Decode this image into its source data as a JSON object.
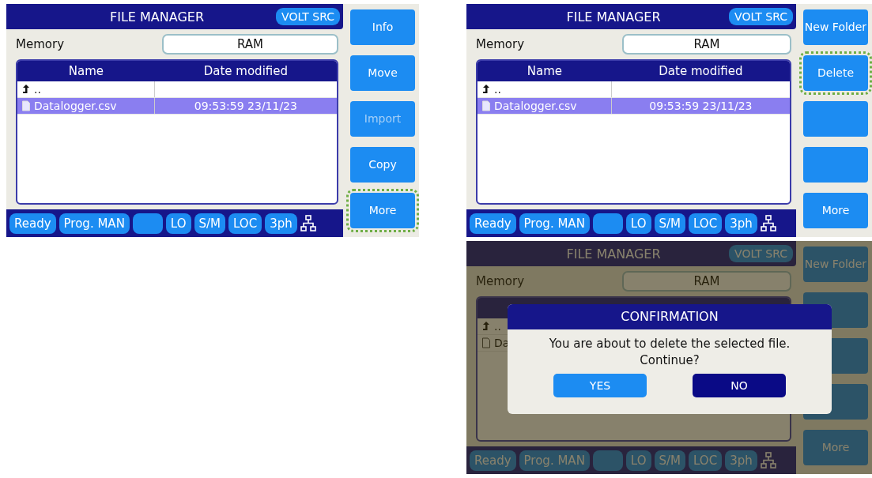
{
  "screens": [
    {
      "title": "FILE MANAGER",
      "mode": "VOLT SRC",
      "dimmed": false,
      "memory": {
        "label": "Memory",
        "value": "RAM"
      },
      "table": {
        "columns": [
          "Name",
          "Date modified"
        ],
        "rows": [
          {
            "kind": "parent",
            "name": "..",
            "selected": false
          },
          {
            "kind": "file",
            "name": "Datalogger.csv",
            "date": "09:53:59 23/11/23",
            "selected": true
          }
        ]
      },
      "status": [
        {
          "kind": "label",
          "text": "Ready"
        },
        {
          "kind": "label",
          "text": "Prog. MAN"
        },
        {
          "kind": "blank"
        },
        {
          "kind": "label",
          "text": "LO"
        },
        {
          "kind": "label",
          "text": "S/M"
        },
        {
          "kind": "label",
          "text": "LOC"
        },
        {
          "kind": "label",
          "text": "3ph"
        }
      ],
      "buttons": [
        {
          "label": "Info",
          "disabled": false,
          "focused": false
        },
        {
          "label": "Move",
          "disabled": false,
          "focused": false
        },
        {
          "label": "Import",
          "disabled": true,
          "focused": false
        },
        {
          "label": "Copy",
          "disabled": false,
          "focused": false
        },
        {
          "label": "More",
          "disabled": false,
          "focused": true
        }
      ]
    },
    {
      "title": "FILE MANAGER",
      "mode": "VOLT SRC",
      "dimmed": false,
      "memory": {
        "label": "Memory",
        "value": "RAM"
      },
      "table": {
        "columns": [
          "Name",
          "Date modified"
        ],
        "rows": [
          {
            "kind": "parent",
            "name": "..",
            "selected": false
          },
          {
            "kind": "file",
            "name": "Datalogger.csv",
            "date": "09:53:59 23/11/23",
            "selected": true
          }
        ]
      },
      "status": [
        {
          "kind": "label",
          "text": "Ready"
        },
        {
          "kind": "label",
          "text": "Prog. MAN"
        },
        {
          "kind": "blank"
        },
        {
          "kind": "label",
          "text": "LO"
        },
        {
          "kind": "label",
          "text": "S/M"
        },
        {
          "kind": "label",
          "text": "LOC"
        },
        {
          "kind": "label",
          "text": "3ph"
        }
      ],
      "buttons": [
        {
          "label": "New Folder",
          "disabled": false,
          "focused": false
        },
        {
          "label": "Delete",
          "disabled": false,
          "focused": true
        },
        {
          "disabled": false,
          "focused": false
        },
        {
          "disabled": false,
          "focused": false
        },
        {
          "label": "More",
          "disabled": false,
          "focused": false
        }
      ]
    },
    {
      "title": "FILE MANAGER",
      "mode": "VOLT SRC",
      "dimmed": true,
      "memory": {
        "label": "Memory",
        "value": "RAM"
      },
      "table": {
        "rows": [
          {
            "kind": "parent",
            "name": "..",
            "selected": false
          },
          {
            "kind": "file",
            "name": "Da",
            "selected": false
          }
        ]
      },
      "status": [
        {
          "kind": "label",
          "text": "Ready"
        },
        {
          "kind": "label",
          "text": "Prog. MAN"
        },
        {
          "kind": "blank"
        },
        {
          "kind": "label",
          "text": "LO"
        },
        {
          "kind": "label",
          "text": "S/M"
        },
        {
          "kind": "label",
          "text": "LOC"
        },
        {
          "kind": "label",
          "text": "3ph"
        }
      ],
      "buttons": [
        {
          "label": "New Folder",
          "disabled": false,
          "focused": false
        },
        {
          "focused": false
        },
        {
          "focused": false
        },
        {
          "focused": false
        },
        {
          "label": "More",
          "disabled": false,
          "focused": false
        }
      ],
      "dialog": {
        "title": "CONFIRMATION",
        "message": "You are about to delete the selected file.\nContinue?",
        "buttons": [
          {
            "label": "YES",
            "kind": "confirm"
          },
          {
            "label": "NO",
            "kind": "cancel"
          }
        ]
      }
    }
  ]
}
